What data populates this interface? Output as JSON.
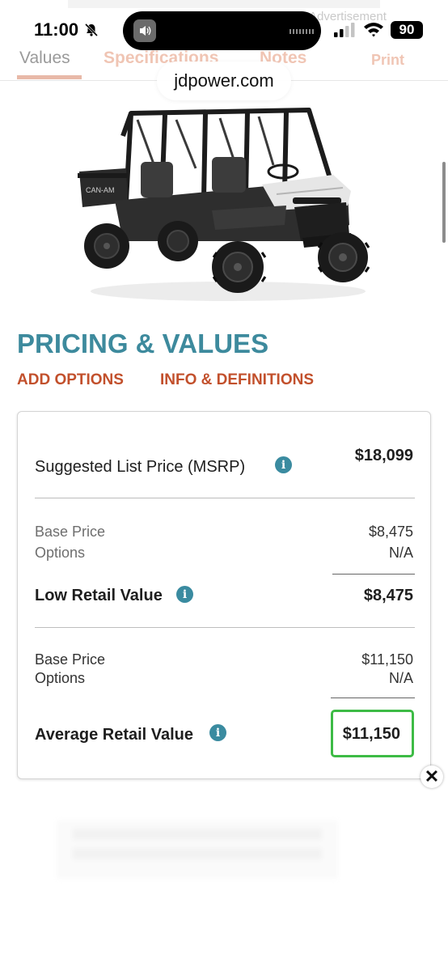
{
  "status_bar": {
    "time": "11:00",
    "battery": "90",
    "ad_label": "Advertisement"
  },
  "tabs": {
    "values": "Values",
    "specifications": "Specifications",
    "notes": "Notes",
    "print": "Print"
  },
  "browser": {
    "url": "jdpower.com"
  },
  "section": {
    "title": "PRICING & VALUES",
    "add_options": "ADD OPTIONS",
    "info_definitions": "INFO & DEFINITIONS"
  },
  "pricing": {
    "msrp": {
      "label": "Suggested List Price (MSRP)",
      "value": "$18,099"
    },
    "low_retail": {
      "base_price_label": "Base Price",
      "base_price_value": "$8,475",
      "options_label": "Options",
      "options_value": "N/A",
      "label": "Low Retail Value",
      "value": "$8,475"
    },
    "average_retail": {
      "base_price_label": "Base Price",
      "base_price_value": "$11,150",
      "options_label": "Options",
      "options_value": "N/A",
      "label": "Average Retail Value",
      "value": "$11,150"
    }
  },
  "icons": {
    "info": "info-icon",
    "close": "close-icon"
  },
  "colors": {
    "accent_teal": "#3d8a9d",
    "link_orange": "#c2502c",
    "highlight_green": "#3dbb45"
  }
}
